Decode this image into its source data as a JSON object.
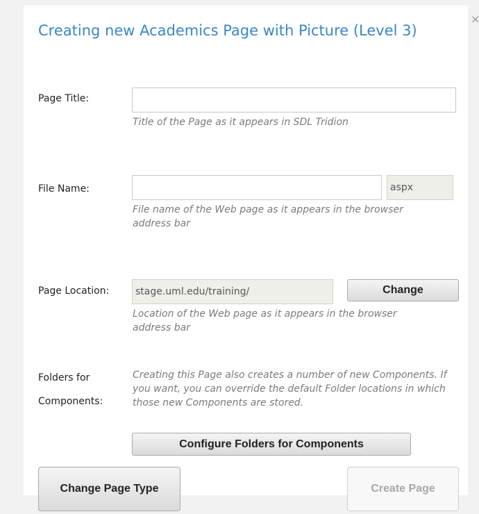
{
  "dialog": {
    "title": "Creating new Academics Page with Picture (Level 3)",
    "close_glyph": "×"
  },
  "page_title": {
    "label": "Page Title:",
    "value": "",
    "hint": "Title of the Page as it appears in SDL Tridion"
  },
  "file_name": {
    "label": "File Name:",
    "value": "",
    "extension": "aspx",
    "hint": "File name of the Web page as it appears in the browser address bar"
  },
  "page_location": {
    "label": "Page Location:",
    "value": "stage.uml.edu/training/",
    "change_label": "Change",
    "hint": "Location of the Web page as it appears in the browser address bar"
  },
  "folders": {
    "label_line1": "Folders for",
    "label_line2": "Components:",
    "hint": "Creating this Page also creates a number of new Components. If you want, you can override the default Folder locations in which those new Components are stored.",
    "configure_label": "Configure Folders for Components"
  },
  "footer": {
    "change_type_label": "Change Page Type",
    "create_label": "Create Page"
  },
  "icons": {
    "close": "close-icon"
  }
}
